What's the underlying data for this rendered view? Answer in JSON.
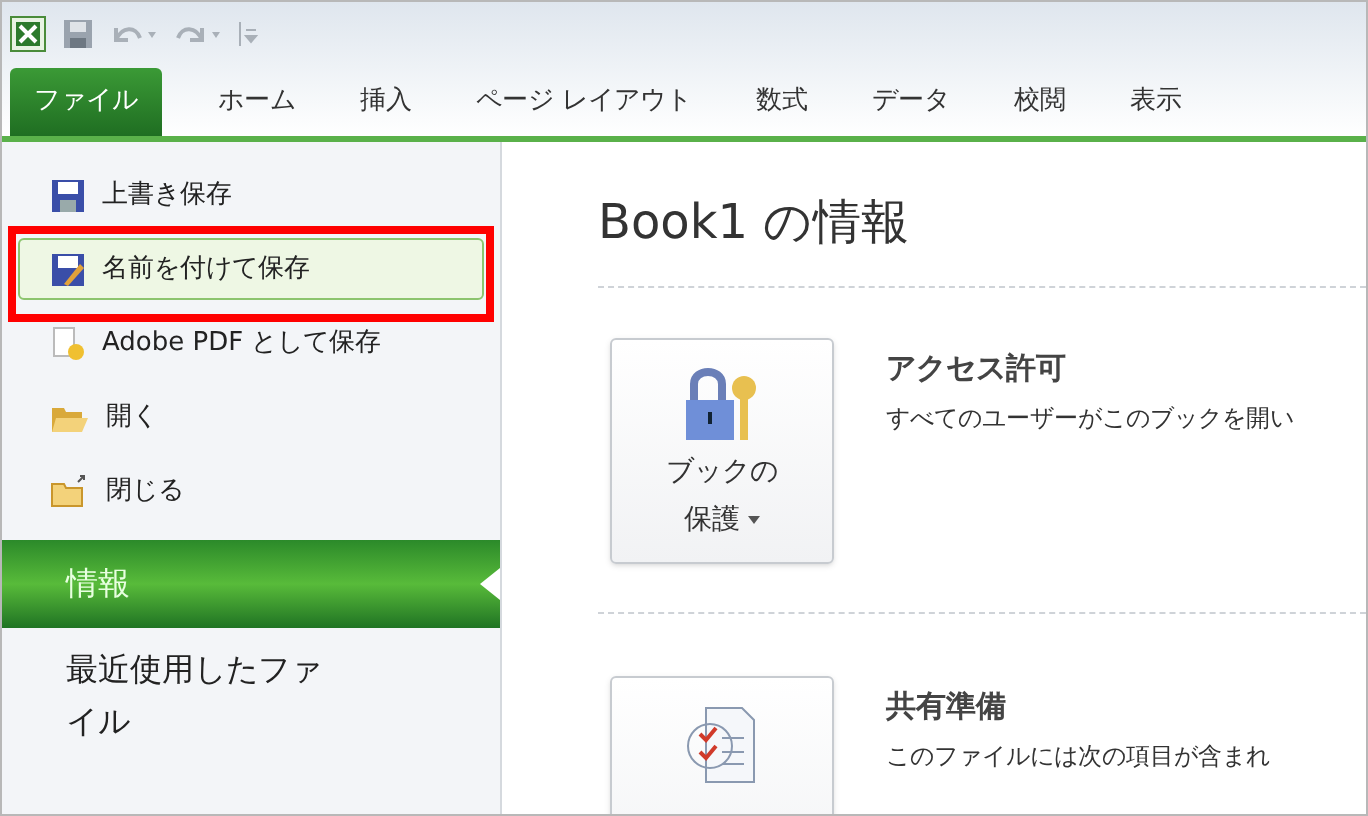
{
  "tabs": [
    {
      "label": "ファイル",
      "selected": true
    },
    {
      "label": "ホーム",
      "selected": false
    },
    {
      "label": "挿入",
      "selected": false
    },
    {
      "label": "ページ レイアウト",
      "selected": false
    },
    {
      "label": "数式",
      "selected": false
    },
    {
      "label": "データ",
      "selected": false
    },
    {
      "label": "校閲",
      "selected": false
    },
    {
      "label": "表示",
      "selected": false
    }
  ],
  "sidebar": {
    "items": [
      {
        "label": "上書き保存",
        "kind": "command",
        "highlighted": false
      },
      {
        "label": "名前を付けて保存",
        "kind": "command",
        "highlighted": true,
        "annotated": true
      },
      {
        "label": "Adobe PDF として保存",
        "kind": "command",
        "highlighted": false
      },
      {
        "label": "開く",
        "kind": "command",
        "highlighted": false
      },
      {
        "label": "閉じる",
        "kind": "command",
        "highlighted": false
      },
      {
        "label": "情報",
        "kind": "page",
        "selected": true
      },
      {
        "label": "最近使用したファイル",
        "kind": "page",
        "selected": false
      }
    ]
  },
  "main": {
    "title": "Book1 の情報",
    "sections": [
      {
        "button_label": [
          "ブックの",
          "保護"
        ],
        "dropdown": true,
        "heading": "アクセス許可",
        "description": "すべてのユーザーがこのブックを開い"
      },
      {
        "heading": "共有準備",
        "description": "このファイルには次の項目が含まれ"
      }
    ]
  }
}
